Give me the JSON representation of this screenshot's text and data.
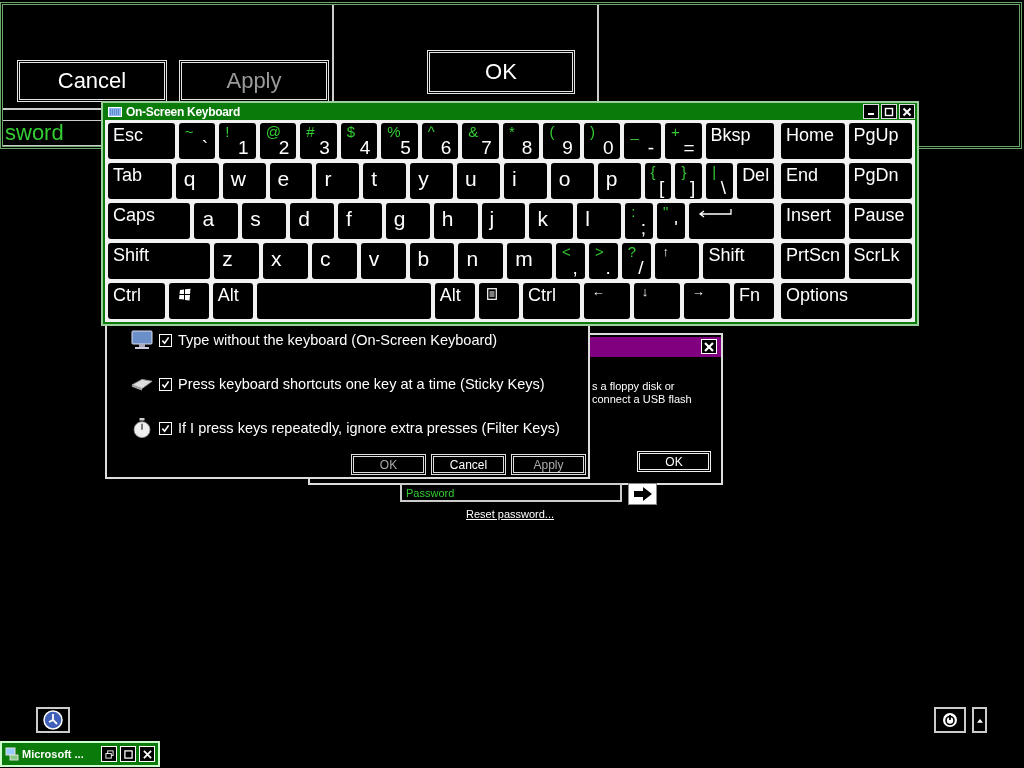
{
  "background_window": {
    "buttons": [
      {
        "label": "Cancel",
        "disabled": false
      },
      {
        "label": "Apply",
        "disabled": true
      }
    ],
    "ok_button": {
      "label": "OK",
      "disabled": false
    },
    "password_field": {
      "placeholder": "sword"
    }
  },
  "message_dialog": {
    "lines": [
      "s a floppy disk or",
      "connect a USB flash"
    ],
    "ok_button": "OK"
  },
  "ease_dialog": {
    "options": [
      {
        "label": "Type without the keyboard (On-Screen Keyboard)",
        "checked": true
      },
      {
        "label": "Press keyboard shortcuts one key at a time (Sticky Keys)",
        "checked": true
      },
      {
        "label": "If I press keys repeatedly, ignore extra presses (Filter Keys)",
        "checked": true
      }
    ],
    "buttons": [
      {
        "label": "OK",
        "disabled": true
      },
      {
        "label": "Cancel",
        "disabled": false
      },
      {
        "label": "Apply",
        "disabled": true
      }
    ]
  },
  "keyboard": {
    "title": "On-Screen Keyboard",
    "rows": [
      {
        "keys": [
          {
            "kind": "label",
            "label": "Esc"
          },
          {
            "kind": "dual",
            "shift": "~",
            "main": "`"
          },
          {
            "kind": "dual",
            "shift": "!",
            "main": "1"
          },
          {
            "kind": "dual",
            "shift": "@",
            "main": "2"
          },
          {
            "kind": "dual",
            "shift": "#",
            "main": "3"
          },
          {
            "kind": "dual",
            "shift": "$",
            "main": "4"
          },
          {
            "kind": "dual",
            "shift": "%",
            "main": "5"
          },
          {
            "kind": "dual",
            "shift": "^",
            "main": "6"
          },
          {
            "kind": "dual",
            "shift": "&",
            "main": "7"
          },
          {
            "kind": "dual",
            "shift": "*",
            "main": "8"
          },
          {
            "kind": "dual",
            "shift": "(",
            "main": "9"
          },
          {
            "kind": "dual",
            "shift": ")",
            "main": "0"
          },
          {
            "kind": "dual",
            "shift": "_",
            "main": "-"
          },
          {
            "kind": "dual",
            "shift": "+",
            "main": "="
          },
          {
            "kind": "label",
            "label": "Bksp"
          }
        ]
      },
      {
        "keys": [
          {
            "kind": "label",
            "label": "Tab"
          },
          {
            "kind": "char",
            "label": "q"
          },
          {
            "kind": "char",
            "label": "w"
          },
          {
            "kind": "char",
            "label": "e"
          },
          {
            "kind": "char",
            "label": "r"
          },
          {
            "kind": "char",
            "label": "t"
          },
          {
            "kind": "char",
            "label": "y"
          },
          {
            "kind": "char",
            "label": "u"
          },
          {
            "kind": "char",
            "label": "i"
          },
          {
            "kind": "char",
            "label": "o"
          },
          {
            "kind": "char",
            "label": "p"
          },
          {
            "kind": "dual",
            "shift": "{",
            "main": "["
          },
          {
            "kind": "dual",
            "shift": "}",
            "main": "]"
          },
          {
            "kind": "dual",
            "shift": "|",
            "main": "\\"
          },
          {
            "kind": "label",
            "label": "Del"
          }
        ]
      },
      {
        "keys": [
          {
            "kind": "label",
            "label": "Caps"
          },
          {
            "kind": "char",
            "label": "a"
          },
          {
            "kind": "char",
            "label": "s"
          },
          {
            "kind": "char",
            "label": "d"
          },
          {
            "kind": "char",
            "label": "f"
          },
          {
            "kind": "char",
            "label": "g"
          },
          {
            "kind": "char",
            "label": "h"
          },
          {
            "kind": "char",
            "label": "j"
          },
          {
            "kind": "char",
            "label": "k"
          },
          {
            "kind": "char",
            "label": "l"
          },
          {
            "kind": "dual",
            "shift": ":",
            "main": ";"
          },
          {
            "kind": "dual",
            "shift": "\"",
            "main": "'"
          },
          {
            "kind": "enter"
          }
        ]
      },
      {
        "keys": [
          {
            "kind": "label",
            "label": "Shift"
          },
          {
            "kind": "char",
            "label": "z"
          },
          {
            "kind": "char",
            "label": "x"
          },
          {
            "kind": "char",
            "label": "c"
          },
          {
            "kind": "char",
            "label": "v"
          },
          {
            "kind": "char",
            "label": "b"
          },
          {
            "kind": "char",
            "label": "n"
          },
          {
            "kind": "char",
            "label": "m"
          },
          {
            "kind": "dual",
            "shift": "<",
            "main": ","
          },
          {
            "kind": "dual",
            "shift": ">",
            "main": "."
          },
          {
            "kind": "dual",
            "shift": "?",
            "main": "/"
          },
          {
            "kind": "arrow",
            "label": "↑"
          },
          {
            "kind": "label",
            "label": "Shift"
          }
        ]
      },
      {
        "keys": [
          {
            "kind": "label",
            "label": "Ctrl"
          },
          {
            "kind": "windows"
          },
          {
            "kind": "label",
            "label": "Alt"
          },
          {
            "kind": "space"
          },
          {
            "kind": "label",
            "label": "Alt"
          },
          {
            "kind": "menu"
          },
          {
            "kind": "label",
            "label": "Ctrl"
          },
          {
            "kind": "arrow",
            "label": "←"
          },
          {
            "kind": "arrow",
            "label": "↓"
          },
          {
            "kind": "arrow",
            "label": "→"
          },
          {
            "kind": "label",
            "label": "Fn"
          }
        ]
      }
    ],
    "nav_rows": [
      [
        "Home",
        "PgUp"
      ],
      [
        "End",
        "PgDn"
      ],
      [
        "Insert",
        "Pause"
      ],
      [
        "PrtScn",
        "ScrLk"
      ],
      [
        "Options"
      ]
    ]
  },
  "login": {
    "password_placeholder": "Password",
    "reset_link": "Reset password..."
  },
  "taskbar": {
    "title": "Microsoft ..."
  }
}
